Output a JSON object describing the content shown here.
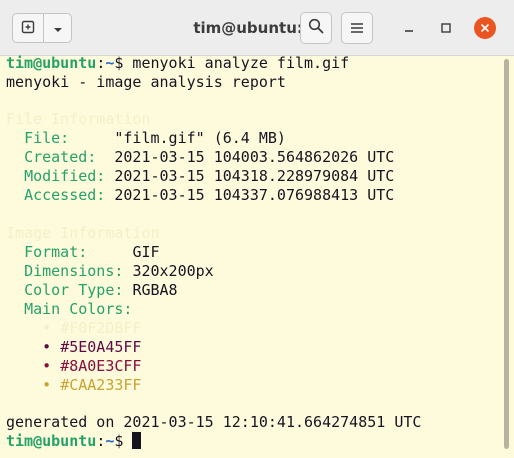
{
  "window": {
    "title": "tim@ubuntu: ~",
    "new_tab_icon": "new-tab-icon",
    "menu_icon": "chevron-down-icon",
    "search_icon": "search-icon",
    "hamburger_icon": "hamburger-icon",
    "minimize_icon": "minimize-icon",
    "maximize_icon": "maximize-icon",
    "close_icon": "close-icon",
    "close_color": "#e95420"
  },
  "terminal": {
    "background": "#fefbdd",
    "prompt": {
      "user_host": "tim@ubuntu",
      "colon": ":",
      "path": "~",
      "symbol": "$"
    },
    "command": " menyoki analyze film.gif",
    "report_header": "menyoki - image analysis report",
    "file_section": {
      "heading": "File Information",
      "rows": [
        {
          "label": "File:",
          "value": "\"film.gif\" (6.4 MB)"
        },
        {
          "label": "Created:",
          "value": "2021-03-15 104003.564862026 UTC"
        },
        {
          "label": "Modified:",
          "value": "2021-03-15 104318.228979084 UTC"
        },
        {
          "label": "Accessed:",
          "value": "2021-03-15 104337.076988413 UTC"
        }
      ]
    },
    "image_section": {
      "heading": "Image Information",
      "rows": [
        {
          "label": "Format:",
          "value": "GIF"
        },
        {
          "label": "Dimensions:",
          "value": "320x200px"
        },
        {
          "label": "Color Type:",
          "value": "RGBA8"
        }
      ],
      "main_colors_label": "Main Colors:",
      "colors": [
        {
          "bullet": "•",
          "hex": "#F0F2DBFF"
        },
        {
          "bullet": "•",
          "hex": "#5E0A45FF"
        },
        {
          "bullet": "•",
          "hex": "#8A0E3CFF"
        },
        {
          "bullet": "•",
          "hex": "#CAA233FF"
        }
      ]
    },
    "generated": "generated on 2021-03-15 12:10:41.664274851 UTC"
  }
}
